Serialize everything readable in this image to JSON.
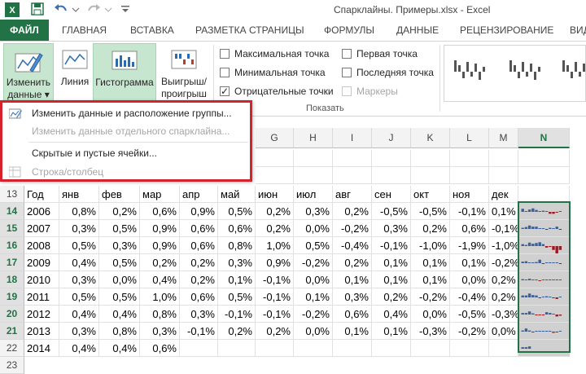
{
  "titlebar": {
    "title": "Спарклайны. Примеры.xlsx - Excel"
  },
  "tabs": {
    "file": "ФАЙЛ",
    "items": [
      "ГЛАВНАЯ",
      "ВСТАВКА",
      "РАЗМЕТКА СТРАНИЦЫ",
      "ФОРМУЛЫ",
      "ДАННЫЕ",
      "РЕЦЕНЗИРОВАНИЕ",
      "ВИД"
    ]
  },
  "ribbon": {
    "edit_data_line1": "Изменить",
    "edit_data_line2": "данные",
    "line": "Линия",
    "histogram": "Гистограмма",
    "winloss_line1": "Выигрыш/",
    "winloss_line2": "проигрыш",
    "show_group": "Показать",
    "checks": [
      {
        "label": "Максимальная точка",
        "checked": false,
        "disabled": false
      },
      {
        "label": "Минимальная точка",
        "checked": false,
        "disabled": false
      },
      {
        "label": "Отрицательные точки",
        "checked": true,
        "disabled": false
      },
      {
        "label": "Первая точка",
        "checked": false,
        "disabled": false
      },
      {
        "label": "Последняя точка",
        "checked": false,
        "disabled": false
      },
      {
        "label": "Маркеры",
        "checked": false,
        "disabled": true
      }
    ]
  },
  "menu": {
    "items": [
      {
        "label": "Изменить данные и расположение группы...",
        "disabled": false
      },
      {
        "label": "Изменить данные отдельного спарклайна...",
        "disabled": true
      },
      {
        "label": "Скрытые и пустые ячейки...",
        "disabled": false
      },
      {
        "label": "Строка/столбец",
        "disabled": true
      }
    ]
  },
  "columns": {
    "visible": [
      "G",
      "H",
      "I",
      "J",
      "K",
      "L",
      "M",
      "N"
    ],
    "selected": "N"
  },
  "table": {
    "header_row": "13",
    "headers": [
      "Год",
      "янв",
      "фев",
      "мар",
      "апр",
      "май",
      "июн",
      "июл",
      "авг",
      "сен",
      "окт",
      "ноя",
      "дек"
    ],
    "rows": [
      {
        "row": "14",
        "cells": [
          "2006",
          "0,8%",
          "0,2%",
          "0,6%",
          "0,9%",
          "0,5%",
          "0,2%",
          "0,3%",
          "0,2%",
          "-0,5%",
          "-0,5%",
          "-0,1%",
          "0,1%"
        ]
      },
      {
        "row": "15",
        "cells": [
          "2007",
          "0,3%",
          "0,5%",
          "0,9%",
          "0,6%",
          "0,6%",
          "0,2%",
          "0,0%",
          "-0,2%",
          "0,3%",
          "0,2%",
          "0,6%",
          "-0,1%"
        ]
      },
      {
        "row": "16",
        "cells": [
          "2008",
          "0,5%",
          "0,3%",
          "0,9%",
          "0,6%",
          "0,8%",
          "1,0%",
          "0,5%",
          "-0,4%",
          "-0,1%",
          "-1,0%",
          "-1,9%",
          "-1,0%"
        ]
      },
      {
        "row": "17",
        "cells": [
          "2009",
          "0,4%",
          "0,5%",
          "0,2%",
          "0,2%",
          "0,3%",
          "0,9%",
          "-0,2%",
          "0,2%",
          "0,1%",
          "0,1%",
          "0,1%",
          "-0,2%"
        ]
      },
      {
        "row": "18",
        "cells": [
          "2010",
          "0,3%",
          "0,0%",
          "0,4%",
          "0,2%",
          "0,1%",
          "-0,1%",
          "0,0%",
          "0,1%",
          "0,1%",
          "0,1%",
          "0,0%",
          "0,2%"
        ]
      },
      {
        "row": "19",
        "cells": [
          "2011",
          "0,5%",
          "0,5%",
          "1,0%",
          "0,6%",
          "0,5%",
          "-0,1%",
          "0,1%",
          "0,3%",
          "0,2%",
          "-0,2%",
          "-0,4%",
          "0,2%"
        ]
      },
      {
        "row": "20",
        "cells": [
          "2012",
          "0,4%",
          "0,4%",
          "0,8%",
          "0,3%",
          "-0,1%",
          "-0,1%",
          "-0,2%",
          "0,6%",
          "0,4%",
          "0,0%",
          "-0,5%",
          "-0,3%"
        ]
      },
      {
        "row": "21",
        "cells": [
          "2013",
          "0,3%",
          "0,8%",
          "0,3%",
          "-0,1%",
          "0,2%",
          "0,2%",
          "0,0%",
          "0,1%",
          "0,1%",
          "-0,3%",
          "-0,2%",
          "0,0%"
        ]
      },
      {
        "row": "22",
        "cells": [
          "2014",
          "0,4%",
          "0,4%",
          "0,6%",
          "",
          "",
          "",
          "",
          "",
          "",
          "",
          "",
          ""
        ]
      }
    ],
    "extra_row": "23"
  },
  "sparkline_values": [
    [
      0.8,
      0.2,
      0.6,
      0.9,
      0.5,
      0.2,
      0.3,
      0.2,
      -0.5,
      -0.5,
      -0.1,
      0.1
    ],
    [
      0.3,
      0.5,
      0.9,
      0.6,
      0.6,
      0.2,
      0.0,
      -0.2,
      0.3,
      0.2,
      0.6,
      -0.1
    ],
    [
      0.5,
      0.3,
      0.9,
      0.6,
      0.8,
      1.0,
      0.5,
      -0.4,
      -0.1,
      -1.0,
      -1.9,
      -1.0
    ],
    [
      0.4,
      0.5,
      0.2,
      0.2,
      0.3,
      0.9,
      -0.2,
      0.2,
      0.1,
      0.1,
      0.1,
      -0.2
    ],
    [
      0.3,
      0.0,
      0.4,
      0.2,
      0.1,
      -0.1,
      0.0,
      0.1,
      0.1,
      0.1,
      0.0,
      0.2
    ],
    [
      0.5,
      0.5,
      1.0,
      0.6,
      0.5,
      -0.1,
      0.1,
      0.3,
      0.2,
      -0.2,
      -0.4,
      0.2
    ],
    [
      0.4,
      0.4,
      0.8,
      0.3,
      -0.1,
      -0.1,
      -0.2,
      0.6,
      0.4,
      0.0,
      -0.5,
      -0.3
    ],
    [
      0.3,
      0.8,
      0.3,
      -0.1,
      0.2,
      0.2,
      0.0,
      0.1,
      0.1,
      -0.3,
      -0.2,
      0.0
    ],
    [
      0.4,
      0.4,
      0.6
    ]
  ],
  "colors": {
    "excel_green": "#217346",
    "spark_positive": "#3a5f9a",
    "spark_negative": "#a4161f",
    "highlight_red": "#d6222c"
  }
}
